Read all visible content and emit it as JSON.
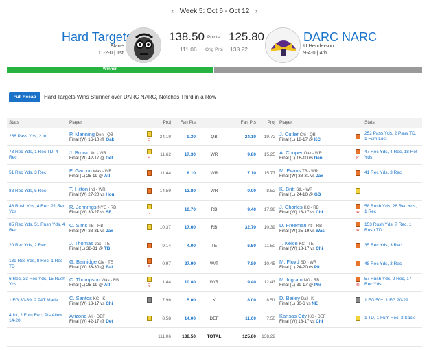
{
  "week_nav": {
    "prev": "‹",
    "label": "Week 5: Oct 6 - Oct 12",
    "next": "›"
  },
  "left_team": {
    "name": "Hard Targets",
    "owner": "Blane",
    "record": "11-2-0 | 1st",
    "score": "138.50",
    "proj": "111.06"
  },
  "right_team": {
    "name": "DARC NARC",
    "owner": "U Henderson",
    "record": "9-4-0 | 4th",
    "score": "125.80",
    "proj": "138.22"
  },
  "labels": {
    "points": "Points",
    "orig_proj": "Orig Proj",
    "winner": "Winner"
  },
  "recap": {
    "button": "Full Recap",
    "headline": "Hard Targets Wins Stunner over DARC NARC, Notches Third in a Row"
  },
  "headers": {
    "stats": "Stats",
    "player": "Player",
    "proj": "Proj",
    "fan_pts": "Fan Pts"
  },
  "rows": [
    {
      "lstats": "268 Pass Yds, 2 Int",
      "lname": "P. Manning",
      "lmeta": "Den - QB",
      "lres": "Final (W) 16-10 @",
      "lopp": "Oak",
      "lnote": "yellow",
      "lflag": "Q",
      "lproj": "24.19",
      "lpts": "9.30",
      "pos": "QB",
      "rpts": "24.10",
      "rproj": "19.72",
      "rname": "J. Cutler",
      "rmeta": "Chi - QB",
      "rres": "Final (L) 18-17 @",
      "ropp": "KC",
      "rnote": "orange",
      "rflag": "",
      "rstats": "252 Pass Yds, 2 Pass TD, 1 Fum Lost"
    },
    {
      "lstats": "73 Rec Yds, 1 Rec TD, 4 Rec",
      "lname": "J. Brown",
      "lmeta": "Ari - WR",
      "lres": "Final (W) 42-17 @",
      "lopp": "Det",
      "lnote": "yellow",
      "lflag": "P",
      "lproj": "11.62",
      "lpts": "17.30",
      "pos": "WR",
      "rpts": "9.80",
      "rproj": "15.25",
      "rname": "A. Cooper",
      "rmeta": "Oak - WR",
      "rres": "Final (L) 16-10 vs",
      "ropp": "Den",
      "rnote": "orange",
      "rflag": "P",
      "rstats": "47 Rec Yds, 4 Rec, 18 Ret Yds"
    },
    {
      "lstats": "51 Rec Yds, 3 Rec",
      "lname": "P. Garcon",
      "lmeta": "Was - WR",
      "lres": "Final (L) 25-19 @",
      "lopp": "Atl",
      "lnote": "orange",
      "lflag": "",
      "lproj": "11.44",
      "lpts": "8.10",
      "pos": "WR",
      "rpts": "7.10",
      "rproj": "15.77",
      "rname": "M. Evans",
      "rmeta": "TB - WR",
      "rres": "Final (W) 38-31 vs",
      "ropp": "Jax",
      "rnote": "orange",
      "rflag": "",
      "rstats": "41 Rec Yds, 3 Rec"
    },
    {
      "lstats": "88 Rec Yds, 5 Rec",
      "lname": "T. Hilton",
      "lmeta": "Ind - WR",
      "lres": "Final (W) 27-20 vs",
      "lopp": "Hou",
      "lnote": "orange",
      "lflag": "",
      "lproj": "14.59",
      "lpts": "13.80",
      "pos": "WR",
      "rpts": "0.00",
      "rproj": "8.52",
      "rname": "K. Britt",
      "rmeta": "StL - WR",
      "rres": "Final (L) 24-10 @",
      "ropp": "GB",
      "rnote": "yellow",
      "rflag": "",
      "rstats": ""
    },
    {
      "lstats": "46 Rush Yds, 4 Rec, 21 Rec Yds",
      "lname": "R. Jennings",
      "lmeta": "NYG - RB",
      "lres": "Final (W) 30-27 vs",
      "lopp": "SF",
      "lnote": "yellow",
      "lflag": "Q",
      "lproj": "",
      "lpts": "10.70",
      "pos": "RB",
      "rpts": "9.40",
      "rproj": "17.98",
      "rname": "J. Charles",
      "rmeta": "KC - RB",
      "rres": "Final (W) 18-17 vs",
      "ropp": "Chi",
      "rnote": "orange",
      "rflag": "IR",
      "rstats": "58 Rush Yds, 26 Rec Yds, 1 Rec"
    },
    {
      "lstats": "85 Rec Yds, 51 Rush Yds, 4 Rec",
      "lname": "C. Sims",
      "lmeta": "TB - RB",
      "lres": "Final (W) 38-31 vs",
      "lopp": "Jax",
      "lnote": "yellow",
      "lflag": "",
      "lproj": "10.37",
      "lpts": "17.60",
      "pos": "RB",
      "rpts": "32.70",
      "rproj": "10.39",
      "rname": "D. Freeman",
      "rmeta": "Atl - RB",
      "rres": "Final (W) 25-19 vs",
      "ropp": "Was",
      "rnote": "orange",
      "rflag": "IR",
      "rstats": "153 Rush Yds, 7 Rec, 1 Rush TD"
    },
    {
      "lstats": "20 Rec Yds, 2 Rec",
      "lname": "J. Thomas",
      "lmeta": "Jax - TE",
      "lres": "Final (L) 38-31 @",
      "lopp": "TB",
      "lnote": "orange",
      "lflag": "",
      "lproj": "9.14",
      "lpts": "4.00",
      "pos": "TE",
      "rpts": "6.50",
      "rproj": "11.50",
      "rname": "T. Kelce",
      "rmeta": "KC - TE",
      "rres": "Final (W) 18-17 vs",
      "ropp": "Chi",
      "rnote": "orange",
      "rflag": "",
      "rstats": "35 Rec Yds, 3 Rec"
    },
    {
      "lstats": "139 Rec Yds, 8 Rec, 1 Rec TD",
      "lname": "G. Barnidge",
      "lmeta": "Cle - TE",
      "lres": "Final (W) 33-30 @",
      "lopp": "Bal",
      "lnote": "orange",
      "lflag": "P",
      "lproj": "0.97",
      "lpts": "27.90",
      "pos": "W/T",
      "rpts": "7.80",
      "rproj": "10.45",
      "rname": "M. Floyd",
      "rmeta": "SD - WR",
      "rres": "Final (L) 24-20 vs",
      "ropp": "Pit",
      "rnote": "orange",
      "rflag": "",
      "rstats": "48 Rec Yds, 3 Rec"
    },
    {
      "lstats": "6 Rec, 33 Rec Yds, 15 Rush Yds",
      "lname": "C. Thompson",
      "lmeta": "Was - RB",
      "lres": "Final (L) 25-19 @",
      "lopp": "Atl",
      "lnote": "yellow",
      "lflag": "Q",
      "lproj": "1.44",
      "lpts": "10.80",
      "pos": "W/R",
      "rpts": "9.40",
      "rproj": "12.43",
      "rname": "M. Ingram",
      "rmeta": "NO - RB",
      "rres": "Final (L) 39-17 @",
      "ropp": "Phi",
      "rnote": "orange",
      "rflag": "IR",
      "rstats": "57 Rush Yds, 2 Rec, 17 Rec Yds"
    },
    {
      "lstats": "1 FG 30-39, 2 PAT Made",
      "lname": "C. Santos",
      "lmeta": "KC - K",
      "lres": "Final (W) 18-17 vs",
      "lopp": "Chi",
      "lnote": "gray",
      "lflag": "",
      "lproj": "7.96",
      "lpts": "5.00",
      "pos": "K",
      "rpts": "8.00",
      "rproj": "8.51",
      "rname": "D. Bailey",
      "rmeta": "Dal - K",
      "rres": "Final (L) 30-6 vs",
      "ropp": "NE",
      "rnote": "gray",
      "rflag": "",
      "rstats": "1 FG 50+, 1 FG 20-29"
    },
    {
      "lstats": "4 Int, 2 Fum Rec, Pts Allow 14-20",
      "lname": "Arizona",
      "lmeta": "Ari - DEF",
      "lres": "Final (W) 42-17 @",
      "lopp": "Det",
      "lnote": "yellow",
      "lflag": "",
      "lproj": "8.58",
      "lpts": "14.00",
      "pos": "DEF",
      "rpts": "11.00",
      "rproj": "7.50",
      "rname": "Kansas City",
      "rmeta": "KC - DEF",
      "rres": "Final (W) 18-17 vs",
      "ropp": "Chi",
      "rnote": "yellow",
      "rflag": "",
      "rstats": "1 TD, 1 Fum Rec, 2 Sack"
    }
  ],
  "totals": {
    "lproj": "111.06",
    "lpts": "138.50",
    "label": "TOTAL",
    "rpts": "125.80",
    "rproj": "138.22"
  },
  "colors": {
    "link": "#1a73c9",
    "winner": "#26b341",
    "loser": "#9a9a9a"
  }
}
